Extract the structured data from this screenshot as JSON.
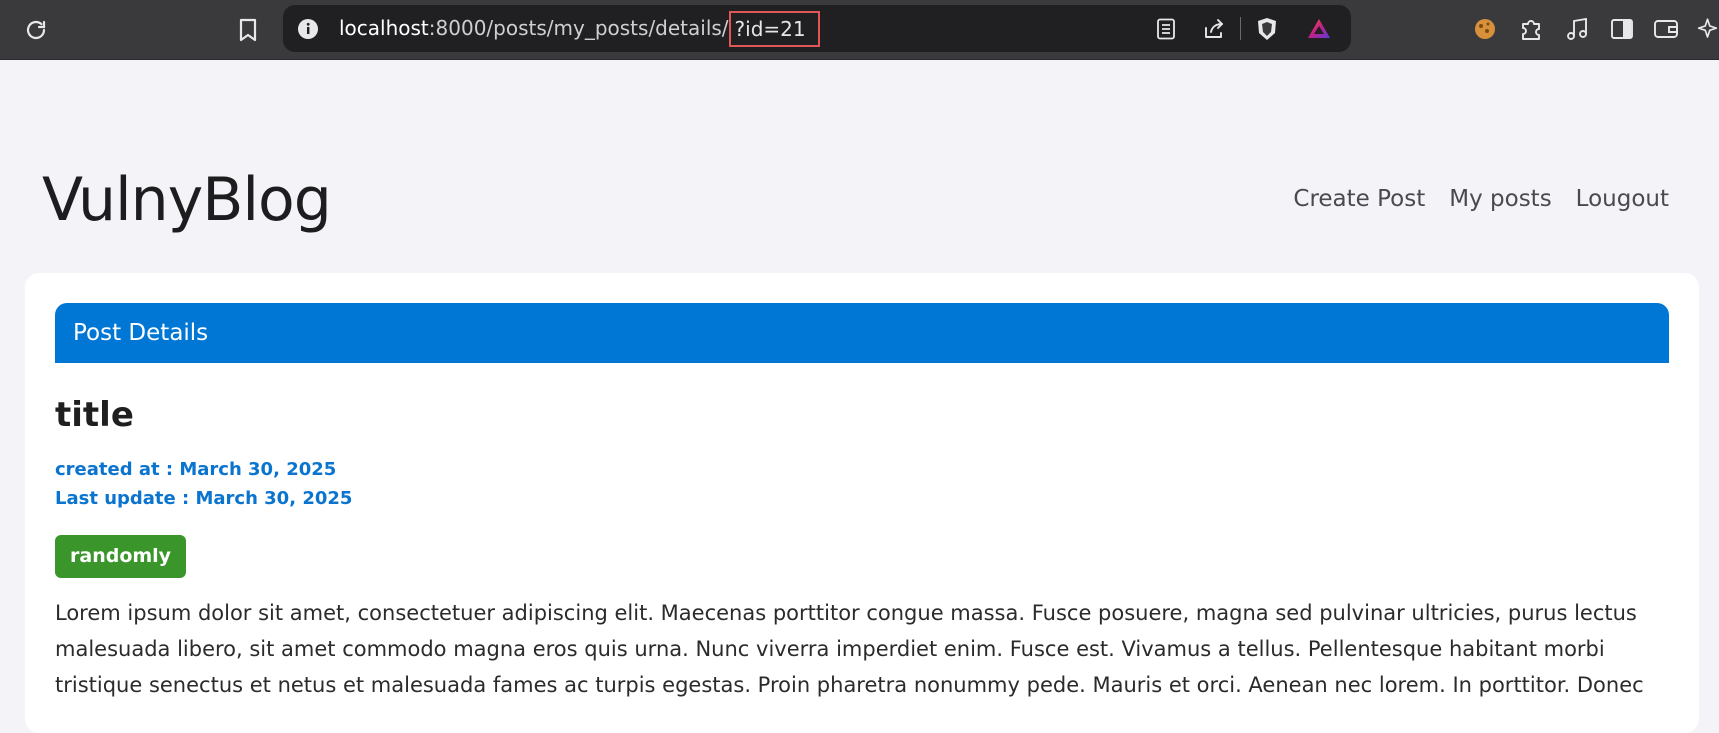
{
  "browser": {
    "url_host": "localhost",
    "url_path": ":8000/posts/my_posts/details/",
    "url_query": "?id=21",
    "icons": [
      "reload-icon",
      "bookmark-icon",
      "site-info-icon",
      "reader-mode-icon",
      "share-icon",
      "brave-shields-icon",
      "brave-rewards-icon",
      "cookie-icon",
      "extensions-icon",
      "media-icon",
      "sidebar-icon",
      "wallet-icon",
      "leo-ai-icon"
    ]
  },
  "site": {
    "title": "VulnyBlog",
    "nav": [
      {
        "label": "Create Post"
      },
      {
        "label": "My posts"
      },
      {
        "label": "Lougout"
      }
    ]
  },
  "post": {
    "header": "Post Details",
    "title": "title",
    "created": "created at : March 30, 2025",
    "updated": "Last update : March 30, 2025",
    "tag": "randomly",
    "body": "Lorem ipsum dolor sit amet, consectetuer adipiscing elit. Maecenas porttitor congue massa. Fusce posuere, magna sed pulvinar ultricies, purus lectus malesuada libero, sit amet commodo magna eros quis urna. Nunc viverra imperdiet enim. Fusce est. Vivamus a tellus. Pellentesque habitant morbi tristique senectus et netus et malesuada fames ac turpis egestas. Proin pharetra nonummy pede. Mauris et orci. Aenean nec lorem. In porttitor. Donec"
  },
  "colors": {
    "header_blue": "#0076d5",
    "tag_green": "#3a962a",
    "meta_blue": "#0a74cf",
    "highlight_red": "#e15656"
  }
}
